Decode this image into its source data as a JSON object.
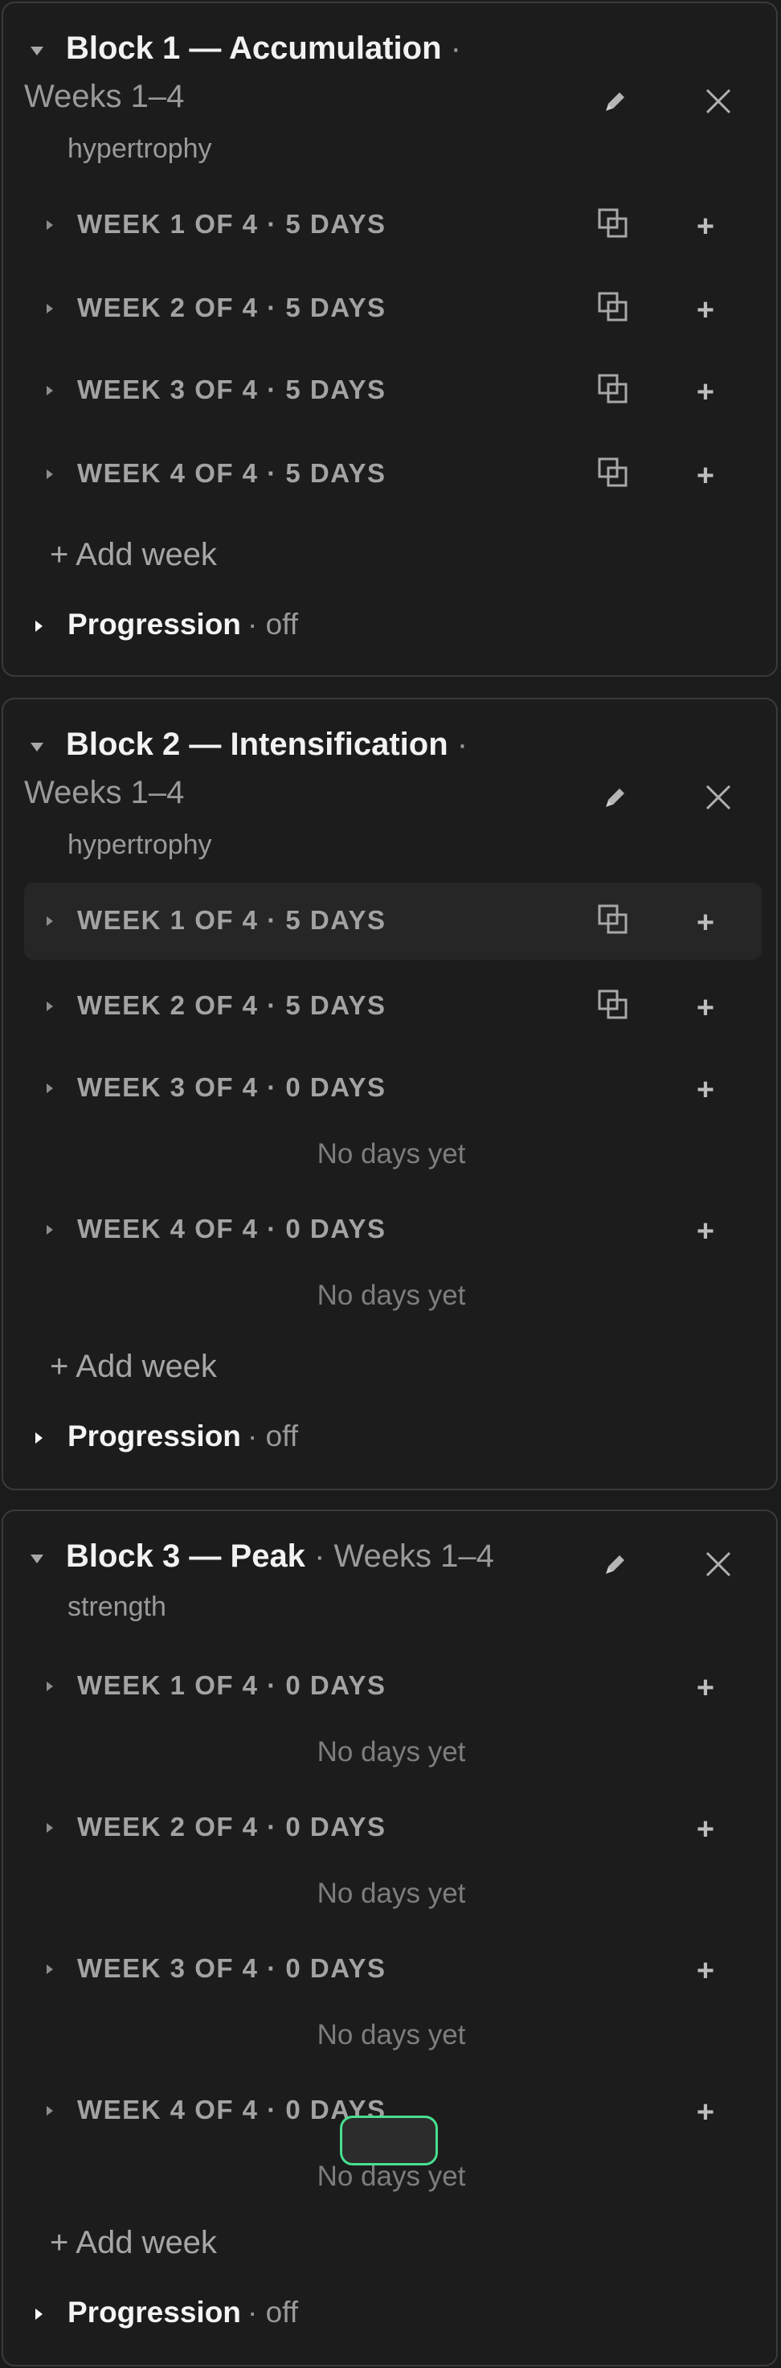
{
  "blocks": [
    {
      "title": "Block 1 — Accumulation",
      "separator": "·",
      "weeks_range": "Weeks 1–4",
      "focus": "hypertrophy",
      "weeks": [
        {
          "label": "WEEK 1 OF 4 · 5 DAYS",
          "has_duplicate": true,
          "empty_text": ""
        },
        {
          "label": "WEEK 2 OF 4 · 5 DAYS",
          "has_duplicate": true,
          "empty_text": ""
        },
        {
          "label": "WEEK 3 OF 4 · 5 DAYS",
          "has_duplicate": true,
          "empty_text": ""
        },
        {
          "label": "WEEK 4 OF 4 · 5 DAYS",
          "has_duplicate": true,
          "empty_text": ""
        }
      ],
      "add_week_label": "+ Add week",
      "progression_label": "Progression",
      "progression_state": "· off"
    },
    {
      "title": "Block 2 — Intensification",
      "separator": "·",
      "weeks_range": "Weeks 1–4",
      "focus": "hypertrophy",
      "weeks": [
        {
          "label": "WEEK 1 OF 4 · 5 DAYS",
          "has_duplicate": true,
          "empty_text": ""
        },
        {
          "label": "WEEK 2 OF 4 · 5 DAYS",
          "has_duplicate": true,
          "empty_text": ""
        },
        {
          "label": "WEEK 3 OF 4 · 0 DAYS",
          "has_duplicate": false,
          "empty_text": "No days yet"
        },
        {
          "label": "WEEK 4 OF 4 · 0 DAYS",
          "has_duplicate": false,
          "empty_text": "No days yet"
        }
      ],
      "add_week_label": "+ Add week",
      "progression_label": "Progression",
      "progression_state": "· off"
    },
    {
      "title": "Block 3 — Peak",
      "separator": "·",
      "weeks_range": "Weeks 1–4",
      "focus": "strength",
      "weeks": [
        {
          "label": "WEEK 1 OF 4 · 0 DAYS",
          "has_duplicate": false,
          "empty_text": "No days yet"
        },
        {
          "label": "WEEK 2 OF 4 · 0 DAYS",
          "has_duplicate": false,
          "empty_text": "No days yet"
        },
        {
          "label": "WEEK 3 OF 4 · 0 DAYS",
          "has_duplicate": false,
          "empty_text": "No days yet"
        },
        {
          "label": "WEEK 4 OF 4 · 0 DAYS",
          "has_duplicate": false,
          "empty_text": "No days yet"
        }
      ],
      "add_week_label": "+ Add week",
      "progression_label": "Progression",
      "progression_state": "· off"
    }
  ],
  "add_day_symbol": "+",
  "icons": {
    "collapse": "caret-down-icon",
    "expand": "caret-right-icon",
    "edit": "pencil-icon",
    "remove": "close-icon",
    "duplicate": "duplicate-icon",
    "add": "plus-icon"
  },
  "colors": {
    "background": "#1b1b1b",
    "card_border": "#3a3a3a",
    "drag_outline": "#48e08f"
  }
}
